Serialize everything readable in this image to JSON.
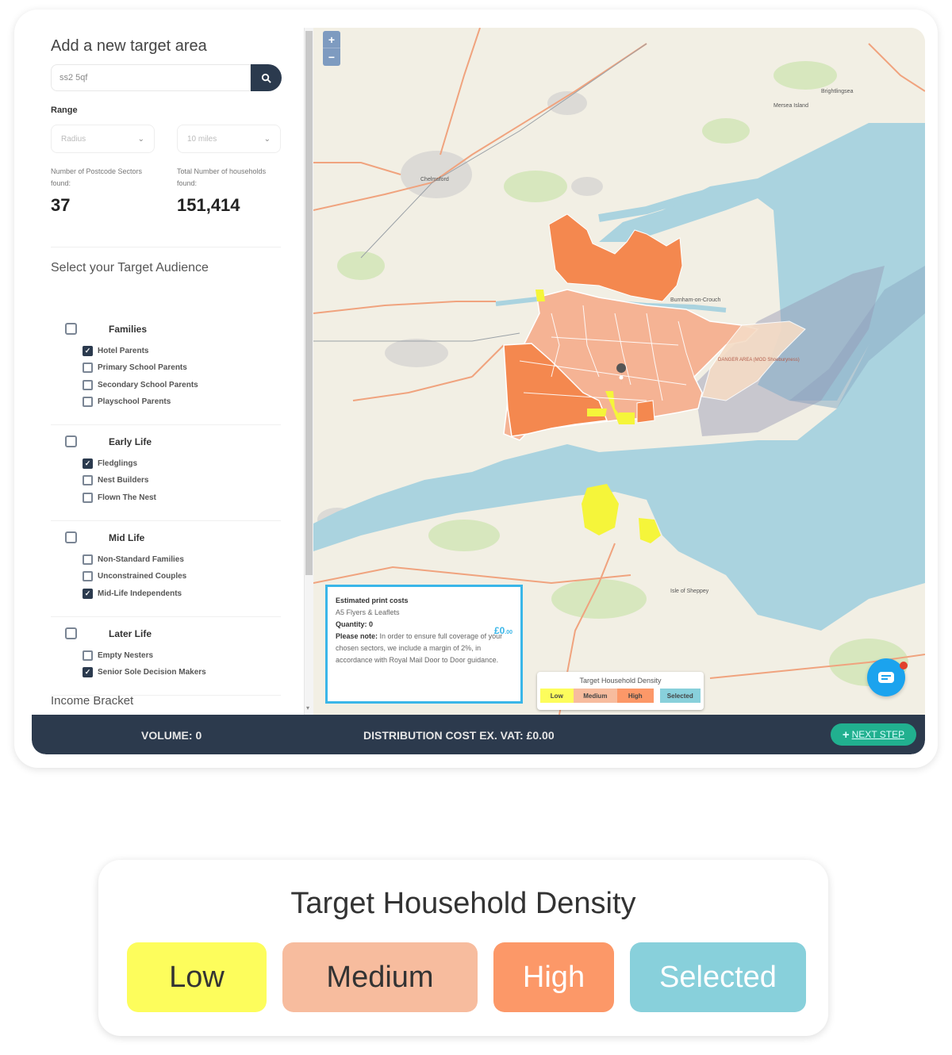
{
  "sidebar": {
    "heading": "Add a new target area",
    "search": {
      "value": "ss2 5qf",
      "button_icon": "search-icon"
    },
    "range": {
      "label": "Range",
      "type_select": "Radius",
      "distance_select": "10 miles"
    },
    "stats": {
      "sectors_label": "Number of Postcode Sectors found:",
      "sectors_value": "37",
      "households_label": "Total Number of households found:",
      "households_value": "151,414"
    },
    "audience_title": "Select your Target Audience",
    "groups": [
      {
        "label": "Families",
        "checked": false,
        "items": [
          {
            "label": "Hotel Parents",
            "checked": true
          },
          {
            "label": "Primary School Parents",
            "checked": false
          },
          {
            "label": "Secondary School Parents",
            "checked": false
          },
          {
            "label": "Playschool Parents",
            "checked": false
          }
        ]
      },
      {
        "label": "Early Life",
        "checked": false,
        "items": [
          {
            "label": "Fledglings",
            "checked": true
          },
          {
            "label": "Nest Builders",
            "checked": false
          },
          {
            "label": "Flown The Nest",
            "checked": false
          }
        ]
      },
      {
        "label": "Mid Life",
        "checked": false,
        "items": [
          {
            "label": "Non-Standard Families",
            "checked": false
          },
          {
            "label": "Unconstrained Couples",
            "checked": false
          },
          {
            "label": "Mid-Life Independents",
            "checked": true
          }
        ]
      },
      {
        "label": "Later Life",
        "checked": false,
        "items": [
          {
            "label": "Empty Nesters",
            "checked": false
          },
          {
            "label": "Senior Sole Decision Makers",
            "checked": true
          }
        ]
      }
    ],
    "income_title": "Income Bracket"
  },
  "map": {
    "zoom_in": "+",
    "zoom_out": "−",
    "place_labels": [
      "Chelmsford",
      "Mersea Island",
      "Brightlingsea",
      "Burnham-on-Crouch",
      "Isle of Sheppey",
      "DANGER AREA (MOD Shoeburyness)"
    ],
    "cost_box": {
      "title": "Estimated print costs",
      "product": "A5 Flyers & Leaflets",
      "quantity_label": "Quantity: 0",
      "price": "£0",
      "price_suffix": ".00",
      "note_label": "Please note:",
      "note_text": " In order to ensure full coverage of your chosen sectors, we include a margin of 2%, in accordance with Royal Mail Door to Door guidance."
    },
    "mini_legend": {
      "title": "Target Household Density",
      "items": [
        "Low",
        "Medium",
        "High",
        "Selected"
      ]
    },
    "chat_icon": "chat-icon"
  },
  "bottom_bar": {
    "volume": "VOLUME: 0",
    "distribution_cost": "DISTRIBUTION COST EX. VAT: £0.00",
    "next_step_icon": "+",
    "next_step": "NEXT STEP"
  },
  "legend": {
    "title": "Target Household Density",
    "items": [
      {
        "label": "Low",
        "color": "#fdfd5c",
        "text_color": "#333333"
      },
      {
        "label": "Medium",
        "color": "#f7bc9e",
        "text_color": "#333333"
      },
      {
        "label": "High",
        "color": "#fc9868",
        "text_color": "#ffffff"
      },
      {
        "label": "Selected",
        "color": "#88d0db",
        "text_color": "#ffffff"
      }
    ]
  },
  "colors": {
    "navy": "#2c3a4d",
    "accent_blue": "#3ab6e8",
    "next_green": "#21b08f",
    "high": "#f4884f",
    "medium": "#f5b394",
    "low": "#f5f53a",
    "sea": "#aad3df",
    "land": "#f2efe4"
  }
}
